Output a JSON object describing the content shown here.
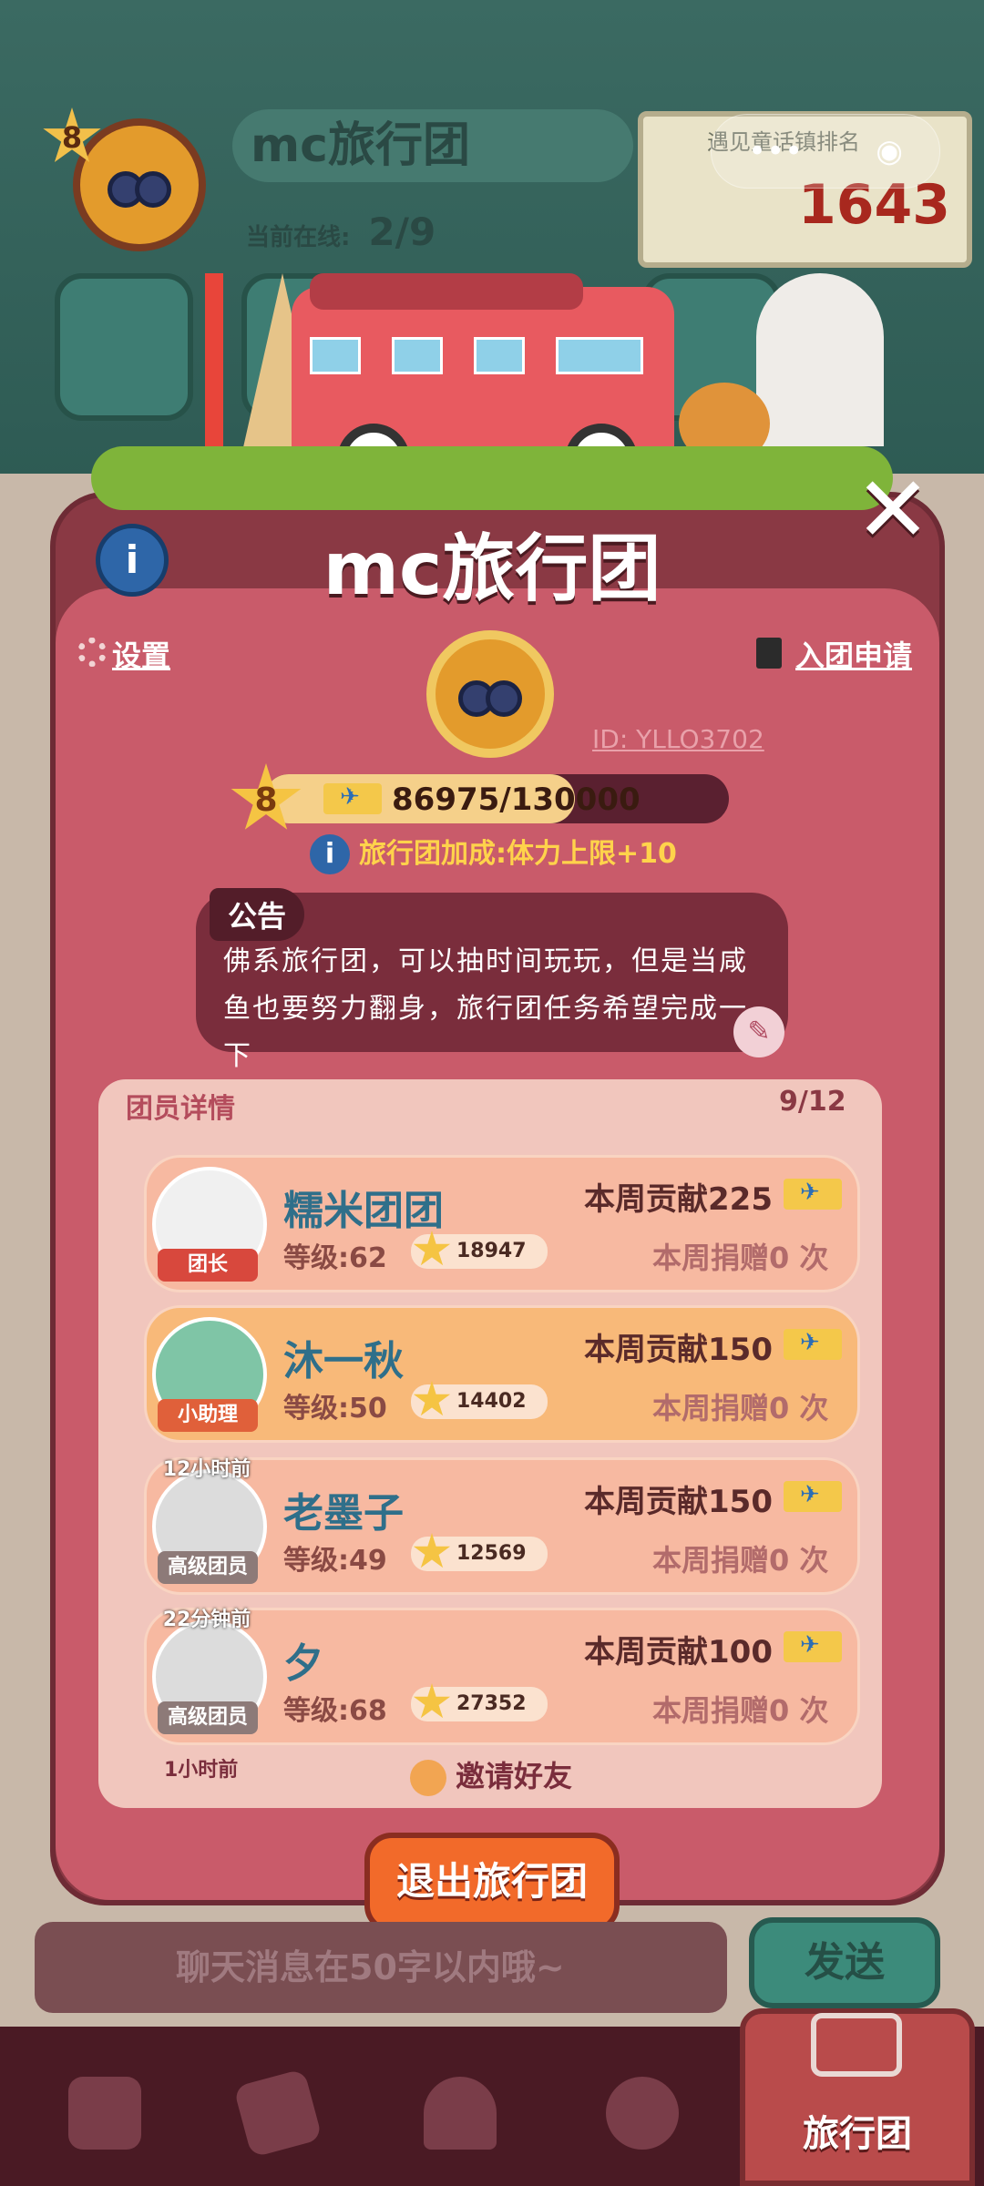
{
  "header": {
    "level": "8",
    "guild_name": "mc旅行团",
    "online_label": "当前在线:",
    "online_value": "2/9",
    "rank_caption": "遇见童话镇排名",
    "rank_value": "1643",
    "capsule_more": "•••",
    "capsule_close": "◉"
  },
  "panel": {
    "title": "mc旅行团",
    "close": "✕",
    "info": "i",
    "settings_label": "设置",
    "apply_label": "入团申请",
    "guild_id": "ID: YLLO3702",
    "level": "8",
    "exp_text": "86975/130000",
    "exp_progress": 0.669,
    "bonus_text": "旅行团加成:体力上限+10",
    "notice_tag": "公告",
    "notice_text": "佛系旅行团，可以抽时间玩玩，但是当咸鱼也要努力翻身，旅行团任务希望完成一下",
    "edit": "✎"
  },
  "members": {
    "header": "团员详情",
    "count": "9/12",
    "list": [
      {
        "name": "糯米团团",
        "level": "等级:62",
        "stars": "18947",
        "contrib": "本周贡献225",
        "donate": "本周捐赠0 次",
        "role": "团长",
        "time": ""
      },
      {
        "name": "沐一秋",
        "level": "等级:50",
        "stars": "14402",
        "contrib": "本周贡献150",
        "donate": "本周捐赠0 次",
        "role": "小助理",
        "time": ""
      },
      {
        "name": "老墨子",
        "level": "等级:49",
        "stars": "12569",
        "contrib": "本周贡献150",
        "donate": "本周捐赠0 次",
        "role": "高级团员",
        "time": "12小时前"
      },
      {
        "name": "夕",
        "level": "等级:68",
        "stars": "27352",
        "contrib": "本周贡献100",
        "donate": "本周捐赠0 次",
        "role": "高级团员",
        "time": "22分钟前"
      }
    ],
    "partial_time": "1小时前",
    "invite": "邀请好友"
  },
  "actions": {
    "exit": "退出旅行团",
    "chat_placeholder": "聊天消息在50字以内哦~",
    "send": "发送"
  },
  "nav": {
    "active_label": "旅行团"
  },
  "colors": {
    "panel": "#8a3944",
    "accent": "#f26a2a",
    "highlight_row": "#f8b979"
  }
}
